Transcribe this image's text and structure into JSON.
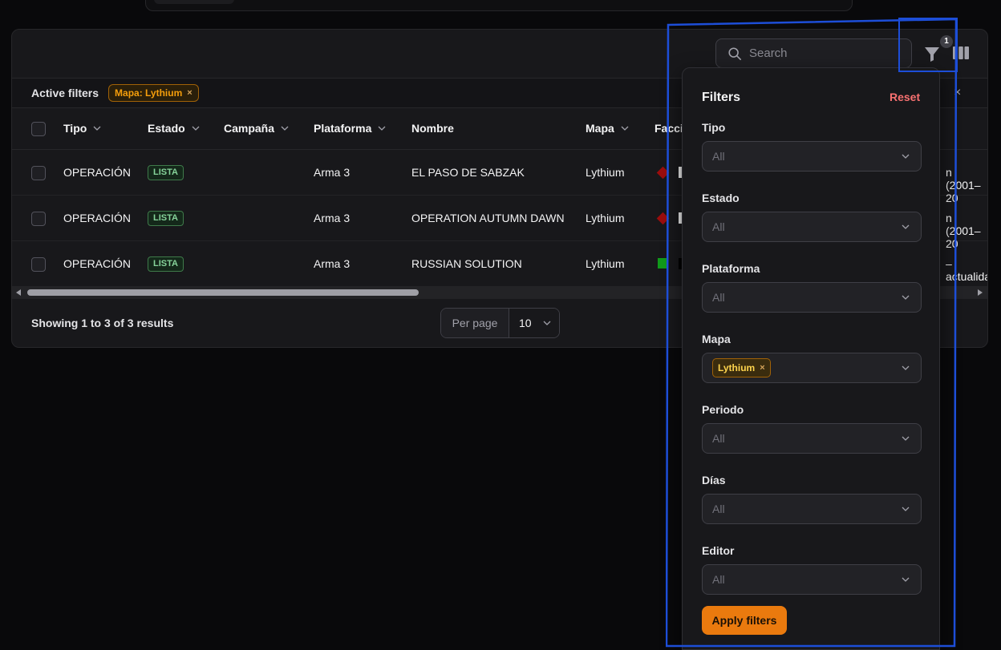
{
  "toolbar": {
    "search_placeholder": "Search",
    "filter_count": "1"
  },
  "active_filters": {
    "label": "Active filters",
    "chips": [
      {
        "text": "Mapa: Lythium",
        "remove": "×"
      }
    ],
    "clear": "×"
  },
  "table": {
    "columns": [
      "Tipo",
      "Estado",
      "Campaña",
      "Plataforma",
      "Nombre",
      "Mapa",
      "Facci"
    ],
    "rows": [
      {
        "tipo": "OPERACIÓN",
        "estado": "LISTA",
        "campana": "",
        "plataforma": "Arma 3",
        "nombre": "EL PASO DE SABZAK",
        "mapa": "Lythium",
        "periodo": "n (2001–20"
      },
      {
        "tipo": "OPERACIÓN",
        "estado": "LISTA",
        "campana": "",
        "plataforma": "Arma 3",
        "nombre": "OPERATION AUTUMN DAWN",
        "mapa": "Lythium",
        "periodo": "n (2001–20"
      },
      {
        "tipo": "OPERACIÓN",
        "estado": "LISTA",
        "campana": "",
        "plataforma": "Arma 3",
        "nombre": "RUSSIAN SOLUTION",
        "mapa": "Lythium",
        "periodo": "–actualida"
      }
    ]
  },
  "footer": {
    "showing": "Showing 1 to 3 of 3 results",
    "per_page_label": "Per page",
    "per_page_value": "10"
  },
  "filters_panel": {
    "title": "Filters",
    "reset": "Reset",
    "fields": [
      {
        "label": "Tipo",
        "value": "All"
      },
      {
        "label": "Estado",
        "value": "All"
      },
      {
        "label": "Plataforma",
        "value": "All"
      },
      {
        "label": "Mapa",
        "value": "",
        "chip": "Lythium",
        "chip_remove": "×"
      },
      {
        "label": "Periodo",
        "value": "All"
      },
      {
        "label": "Días",
        "value": "All"
      },
      {
        "label": "Editor",
        "value": "All"
      }
    ],
    "apply": "Apply filters"
  },
  "colors": {
    "accent": "#ea7a0e",
    "reset": "#f87171",
    "highlight": "#1d4ed8"
  }
}
